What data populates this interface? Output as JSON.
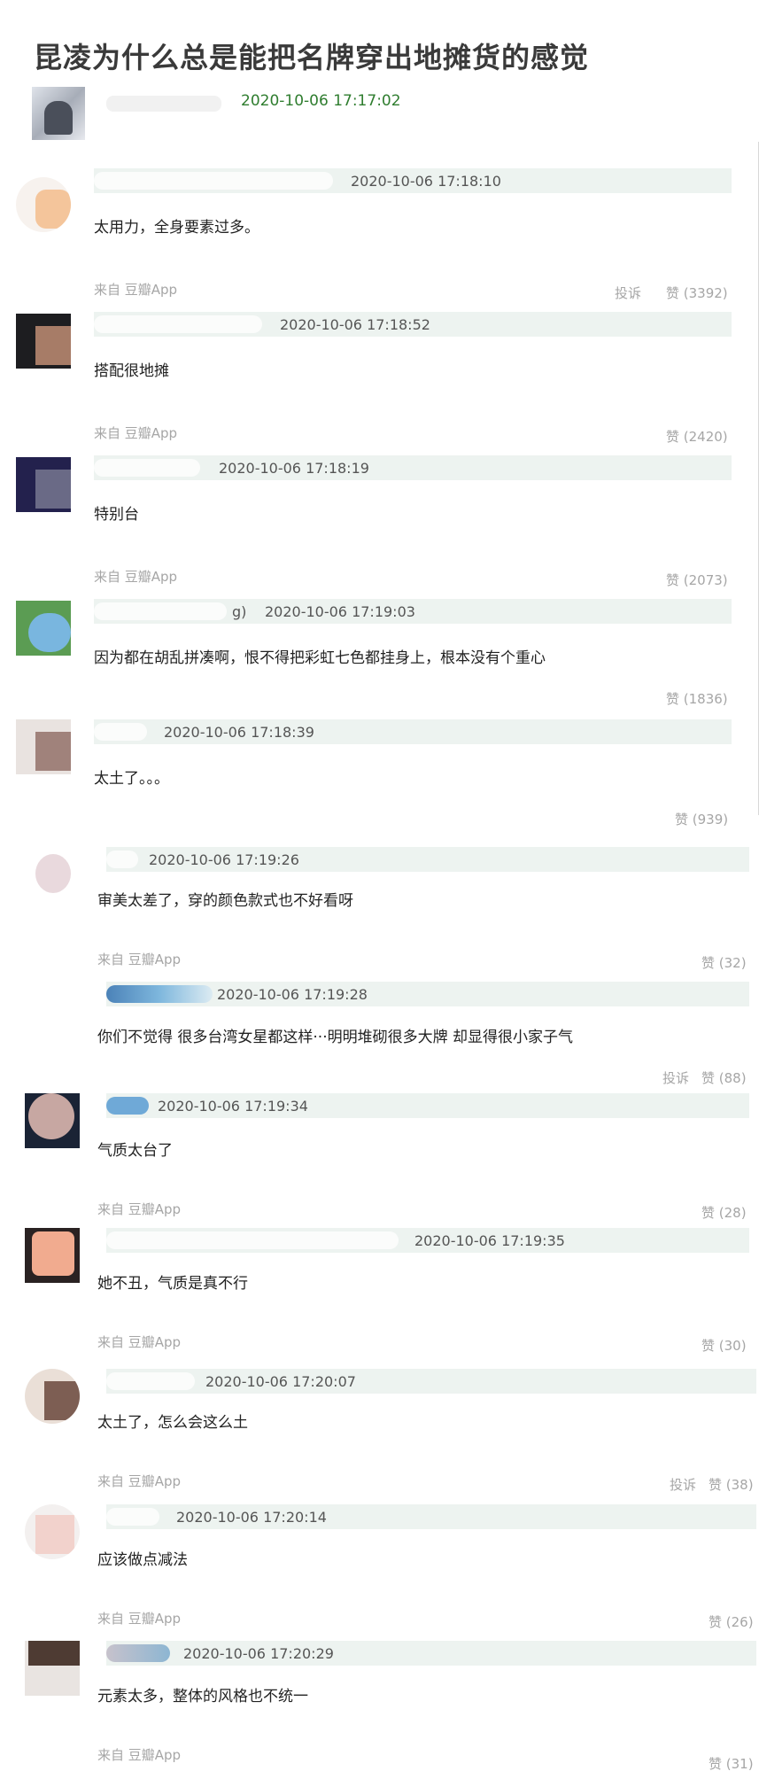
{
  "post": {
    "title": "昆凌为什么总是能把名牌穿出地摊货的感觉",
    "time": "2020-10-06 17:17:02"
  },
  "comments": [
    {
      "time": "2020-10-06 17:18:10",
      "content": "太用力，全身要素过多。",
      "source": "来自 豆瓣App",
      "report": "投诉",
      "likes": "赞 (3392)"
    },
    {
      "time": "2020-10-06 17:18:52",
      "content": "搭配很地摊",
      "source": "来自 豆瓣App",
      "likes": "赞 (2420)"
    },
    {
      "time": "2020-10-06 17:18:19",
      "content": "特别台",
      "source": "来自 豆瓣App",
      "likes": "赞 (2073)"
    },
    {
      "name_tail": "g)",
      "time": "2020-10-06 17:19:03",
      "content": "因为都在胡乱拼凑啊，恨不得把彩虹七色都挂身上，根本没有个重心",
      "likes": "赞 (1836)"
    },
    {
      "time": "2020-10-06 17:18:39",
      "content": "太土了。。。",
      "likes": "赞 (939)"
    },
    {
      "time": "2020-10-06 17:19:26",
      "content": "审美太差了，穿的颜色款式也不好看呀",
      "source": "来自 豆瓣App",
      "likes": "赞 (32)"
    },
    {
      "time": "2020-10-06 17:19:28",
      "content": "你们不觉得 很多台湾女星都这样···明明堆砌很多大牌 却显得很小家子气",
      "report": "投诉",
      "likes": "赞 (88)"
    },
    {
      "time": "2020-10-06 17:19:34",
      "content": "气质太台了",
      "source": "来自 豆瓣App",
      "likes": "赞 (28)"
    },
    {
      "time": "2020-10-06 17:19:35",
      "content": "她不丑，气质是真不行",
      "source": "来自 豆瓣App",
      "likes": "赞 (30)"
    },
    {
      "time": "2020-10-06 17:20:07",
      "content": "太土了，怎么会这么土",
      "source": "来自 豆瓣App",
      "report": "投诉",
      "likes": "赞 (38)"
    },
    {
      "time": "2020-10-06 17:20:14",
      "content": "应该做点减法",
      "source": "来自 豆瓣App",
      "likes": "赞 (26)"
    },
    {
      "time": "2020-10-06 17:20:29",
      "content": "元素太多，整体的风格也不统一",
      "source": "来自 豆瓣App",
      "likes": "赞 (31)"
    }
  ],
  "colors": {
    "accent_time": "#2f7d2f",
    "header_bar": "#edf3f0",
    "muted": "#a6a6a6"
  }
}
